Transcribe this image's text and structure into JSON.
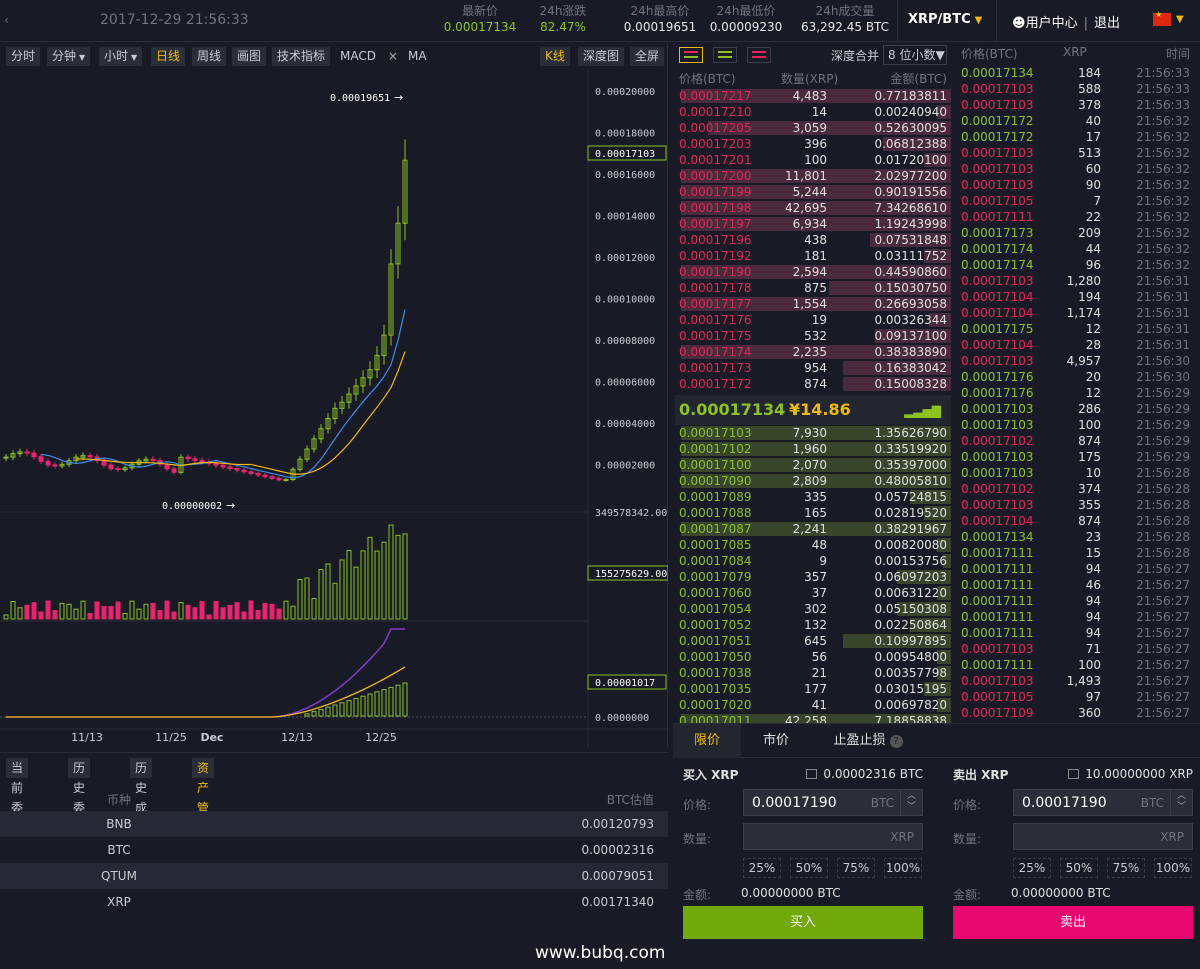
{
  "header": {
    "back": "‹",
    "datetime": "2017-12-29 21:56:33",
    "stats": [
      {
        "label": "最新价",
        "value": "0.00017134",
        "color": "green"
      },
      {
        "label": "24h涨跌",
        "value": "82.47%",
        "color": "green"
      },
      {
        "label": "24h最高价",
        "value": "0.00019651",
        "color": "white"
      },
      {
        "label": "24h最低价",
        "value": "0.00009230",
        "color": "white"
      },
      {
        "label": "24h成交量",
        "value": "63,292.45 BTC",
        "color": "white"
      }
    ],
    "pair": "XRP/BTC",
    "user_center": "用户中心",
    "logout": "退出",
    "separator": "|",
    "language_flag": "cn-flag-icon"
  },
  "chart_toolbar": {
    "buttons": [
      "分时",
      "分钟",
      "小时",
      "日线",
      "周线",
      "画图",
      "技术指标"
    ],
    "active": "日线",
    "macd": "MACD",
    "close": "×",
    "ma": "MA",
    "right_buttons": [
      "K线",
      "深度图",
      "全屏"
    ],
    "right_active": "K线"
  },
  "chart_data": {
    "type": "candlestick",
    "main_axis_labels": [
      "0.00020000",
      "0.00018000",
      "0.00016000",
      "0.00014000",
      "0.00012000",
      "0.00010000",
      "0.00008000",
      "0.00006000",
      "0.00004000",
      "0.00002000"
    ],
    "high_marker": "0.00019651",
    "low_marker": "0.00000002",
    "current_price_tag": "0.00017103",
    "volume_axis_label": "349578342.00",
    "volume_tag": "155275629.00",
    "macd_tag": "0.00001017",
    "macd_zero_label": "0.0000000",
    "x_labels": [
      "11/13",
      "11/25",
      "Dec",
      "12/13",
      "12/25"
    ],
    "colors": {
      "up": "#8dc21f",
      "down": "#e8246e",
      "ma5": "#3a8ee6",
      "ma10": "#f0b90b",
      "macd_line": "#7e3cc8"
    }
  },
  "asset_tabs": [
    "当前委托",
    "历史委托",
    "历史成交",
    "资产管理"
  ],
  "asset_active": "资产管理",
  "assets": {
    "headers": {
      "coin": "币种",
      "btc": "BTC估值"
    },
    "rows": [
      {
        "coin": "BNB",
        "btc": "0.00120793"
      },
      {
        "coin": "BTC",
        "btc": "0.00002316"
      },
      {
        "coin": "QTUM",
        "btc": "0.00079051"
      },
      {
        "coin": "XRP",
        "btc": "0.00171340"
      }
    ]
  },
  "watermark": "www.bubq.com",
  "orderbook": {
    "depth_label": "深度合并",
    "depth_select": "8 位小数▼",
    "headers": {
      "price": "价格(BTC)",
      "qty": "数量(XRP)",
      "amount": "金额(BTC)"
    },
    "asks": [
      {
        "p": "0.00017217",
        "q": "4,483",
        "a": "0.77183811",
        "w": 1.0
      },
      {
        "p": "0.00017210",
        "q": "14",
        "a": "0.00240940",
        "w": 0.05
      },
      {
        "p": "0.00017205",
        "q": "3,059",
        "a": "0.52630095",
        "w": 0.9
      },
      {
        "p": "0.00017203",
        "q": "396",
        "a": "0.06812388",
        "w": 0.25
      },
      {
        "p": "0.00017201",
        "q": "100",
        "a": "0.01720100",
        "w": 0.1
      },
      {
        "p": "0.00017200",
        "q": "11,801",
        "a": "2.02977200",
        "w": 1.0
      },
      {
        "p": "0.00017199",
        "q": "5,244",
        "a": "0.90191556",
        "w": 1.0
      },
      {
        "p": "0.00017198",
        "q": "42,695",
        "a": "7.34268610",
        "w": 1.0
      },
      {
        "p": "0.00017197",
        "q": "6,934",
        "a": "1.19243998",
        "w": 1.0
      },
      {
        "p": "0.00017196",
        "q": "438",
        "a": "0.07531848",
        "w": 0.3
      },
      {
        "p": "0.00017192",
        "q": "181",
        "a": "0.03111752",
        "w": 0.1
      },
      {
        "p": "0.00017190",
        "q": "2,594",
        "a": "0.44590860",
        "w": 1.0
      },
      {
        "p": "0.00017178",
        "q": "875",
        "a": "0.15030750",
        "w": 0.45
      },
      {
        "p": "0.00017177",
        "q": "1,554",
        "a": "0.26693058",
        "w": 1.0
      },
      {
        "p": "0.00017176",
        "q": "19",
        "a": "0.00326344",
        "w": 0.08
      },
      {
        "p": "0.00017175",
        "q": "532",
        "a": "0.09137100",
        "w": 0.28
      },
      {
        "p": "0.00017174",
        "q": "2,235",
        "a": "0.38383890",
        "w": 1.0
      },
      {
        "p": "0.00017173",
        "q": "954",
        "a": "0.16383042",
        "w": 0.4
      },
      {
        "p": "0.00017172",
        "q": "874",
        "a": "0.15008328",
        "w": 0.4
      }
    ],
    "last_price": "0.00017134",
    "last_arrow": "↑",
    "last_cny": "¥14.86",
    "signal_icon": "signal-bars-icon",
    "bids": [
      {
        "p": "0.00017103",
        "q": "7,930",
        "a": "1.35626790",
        "w": 1.0
      },
      {
        "p": "0.00017102",
        "q": "1,960",
        "a": "0.33519920",
        "w": 1.0
      },
      {
        "p": "0.00017100",
        "q": "2,070",
        "a": "0.35397000",
        "w": 1.0
      },
      {
        "p": "0.00017090",
        "q": "2,809",
        "a": "0.48005810",
        "w": 1.0
      },
      {
        "p": "0.00017089",
        "q": "335",
        "a": "0.05724815",
        "w": 0.15
      },
      {
        "p": "0.00017088",
        "q": "165",
        "a": "0.02819520",
        "w": 0.1
      },
      {
        "p": "0.00017087",
        "q": "2,241",
        "a": "0.38291967",
        "w": 1.0
      },
      {
        "p": "0.00017085",
        "q": "48",
        "a": "0.00820080",
        "w": 0.05
      },
      {
        "p": "0.00017084",
        "q": "9",
        "a": "0.00153756",
        "w": 0.03
      },
      {
        "p": "0.00017079",
        "q": "357",
        "a": "0.06097203",
        "w": 0.2
      },
      {
        "p": "0.00017060",
        "q": "37",
        "a": "0.00631220",
        "w": 0.05
      },
      {
        "p": "0.00017054",
        "q": "302",
        "a": "0.05150308",
        "w": 0.2
      },
      {
        "p": "0.00017052",
        "q": "132",
        "a": "0.02250864",
        "w": 0.15
      },
      {
        "p": "0.00017051",
        "q": "645",
        "a": "0.10997895",
        "w": 0.4
      },
      {
        "p": "0.00017050",
        "q": "56",
        "a": "0.00954800",
        "w": 0.05
      },
      {
        "p": "0.00017038",
        "q": "21",
        "a": "0.00357798",
        "w": 0.05
      },
      {
        "p": "0.00017035",
        "q": "177",
        "a": "0.03015195",
        "w": 0.1
      },
      {
        "p": "0.00017020",
        "q": "41",
        "a": "0.00697820",
        "w": 0.05
      },
      {
        "p": "0.00017011",
        "q": "42,258",
        "a": "7.18858838",
        "w": 1.0
      }
    ]
  },
  "trades": {
    "headers": {
      "price": "价格(BTC)",
      "qty": "XRP",
      "time": "时间"
    },
    "rows": [
      {
        "p": "0.00017134",
        "q": "184",
        "t": "21:56:33",
        "s": "g"
      },
      {
        "p": "0.00017103",
        "q": "588",
        "t": "21:56:33",
        "s": "r"
      },
      {
        "p": "0.00017103",
        "q": "378",
        "t": "21:56:33",
        "s": "r"
      },
      {
        "p": "0.00017172",
        "q": "40",
        "t": "21:56:32",
        "s": "g"
      },
      {
        "p": "0.00017172",
        "q": "17",
        "t": "21:56:32",
        "s": "g"
      },
      {
        "p": "0.00017103",
        "q": "513",
        "t": "21:56:32",
        "s": "r"
      },
      {
        "p": "0.00017103",
        "q": "60",
        "t": "21:56:32",
        "s": "r"
      },
      {
        "p": "0.00017103",
        "q": "90",
        "t": "21:56:32",
        "s": "r"
      },
      {
        "p": "0.00017105",
        "q": "7",
        "t": "21:56:32",
        "s": "r"
      },
      {
        "p": "0.00017111",
        "q": "22",
        "t": "21:56:32",
        "s": "r"
      },
      {
        "p": "0.00017173",
        "q": "209",
        "t": "21:56:32",
        "s": "g"
      },
      {
        "p": "0.00017174",
        "q": "44",
        "t": "21:56:32",
        "s": "g"
      },
      {
        "p": "0.00017174",
        "q": "96",
        "t": "21:56:32",
        "s": "g"
      },
      {
        "p": "0.00017103",
        "q": "1,280",
        "t": "21:56:31",
        "s": "r"
      },
      {
        "p": "0.00017104",
        "q": "194",
        "t": "21:56:31",
        "s": "r"
      },
      {
        "p": "0.00017104",
        "q": "1,174",
        "t": "21:56:31",
        "s": "r"
      },
      {
        "p": "0.00017175",
        "q": "12",
        "t": "21:56:31",
        "s": "g"
      },
      {
        "p": "0.00017104",
        "q": "28",
        "t": "21:56:31",
        "s": "r"
      },
      {
        "p": "0.00017103",
        "q": "4,957",
        "t": "21:56:30",
        "s": "r"
      },
      {
        "p": "0.00017176",
        "q": "20",
        "t": "21:56:30",
        "s": "g"
      },
      {
        "p": "0.00017176",
        "q": "12",
        "t": "21:56:29",
        "s": "g"
      },
      {
        "p": "0.00017103",
        "q": "286",
        "t": "21:56:29",
        "s": "g"
      },
      {
        "p": "0.00017103",
        "q": "100",
        "t": "21:56:29",
        "s": "g"
      },
      {
        "p": "0.00017102",
        "q": "874",
        "t": "21:56:29",
        "s": "r"
      },
      {
        "p": "0.00017103",
        "q": "175",
        "t": "21:56:29",
        "s": "g"
      },
      {
        "p": "0.00017103",
        "q": "10",
        "t": "21:56:28",
        "s": "g"
      },
      {
        "p": "0.00017102",
        "q": "374",
        "t": "21:56:28",
        "s": "r"
      },
      {
        "p": "0.00017103",
        "q": "355",
        "t": "21:56:28",
        "s": "r"
      },
      {
        "p": "0.00017104",
        "q": "874",
        "t": "21:56:28",
        "s": "r"
      },
      {
        "p": "0.00017134",
        "q": "23",
        "t": "21:56:28",
        "s": "g"
      },
      {
        "p": "0.00017111",
        "q": "15",
        "t": "21:56:28",
        "s": "g"
      },
      {
        "p": "0.00017111",
        "q": "94",
        "t": "21:56:27",
        "s": "g"
      },
      {
        "p": "0.00017111",
        "q": "46",
        "t": "21:56:27",
        "s": "g"
      },
      {
        "p": "0.00017111",
        "q": "94",
        "t": "21:56:27",
        "s": "g"
      },
      {
        "p": "0.00017111",
        "q": "94",
        "t": "21:56:27",
        "s": "g"
      },
      {
        "p": "0.00017111",
        "q": "94",
        "t": "21:56:27",
        "s": "g"
      },
      {
        "p": "0.00017103",
        "q": "71",
        "t": "21:56:27",
        "s": "r"
      },
      {
        "p": "0.00017111",
        "q": "100",
        "t": "21:56:27",
        "s": "g"
      },
      {
        "p": "0.00017103",
        "q": "1,493",
        "t": "21:56:27",
        "s": "r"
      },
      {
        "p": "0.00017105",
        "q": "97",
        "t": "21:56:27",
        "s": "r"
      },
      {
        "p": "0.00017109",
        "q": "360",
        "t": "21:56:27",
        "s": "r"
      }
    ]
  },
  "trade_form": {
    "tabs": [
      "限价",
      "市价",
      "止盈止损"
    ],
    "active_tab": "限价",
    "help": "?",
    "buy": {
      "title": "买入 XRP",
      "balance": "0.00002316 BTC",
      "price_label": "价格:",
      "price": "0.00017190",
      "price_unit": "BTC",
      "qty_label": "数量:",
      "qty_unit": "XRP",
      "amount_label": "金额:",
      "amount": "0.00000000 BTC",
      "button": "买入"
    },
    "sell": {
      "title": "卖出 XRP",
      "balance": "10.00000000 XRP",
      "price_label": "价格:",
      "price": "0.00017190",
      "price_unit": "BTC",
      "qty_label": "数量:",
      "qty_unit": "XRP",
      "amount_label": "金额:",
      "amount": "0.00000000 BTC",
      "button": "卖出"
    },
    "percents": [
      "25%",
      "50%",
      "75%",
      "100%"
    ]
  }
}
